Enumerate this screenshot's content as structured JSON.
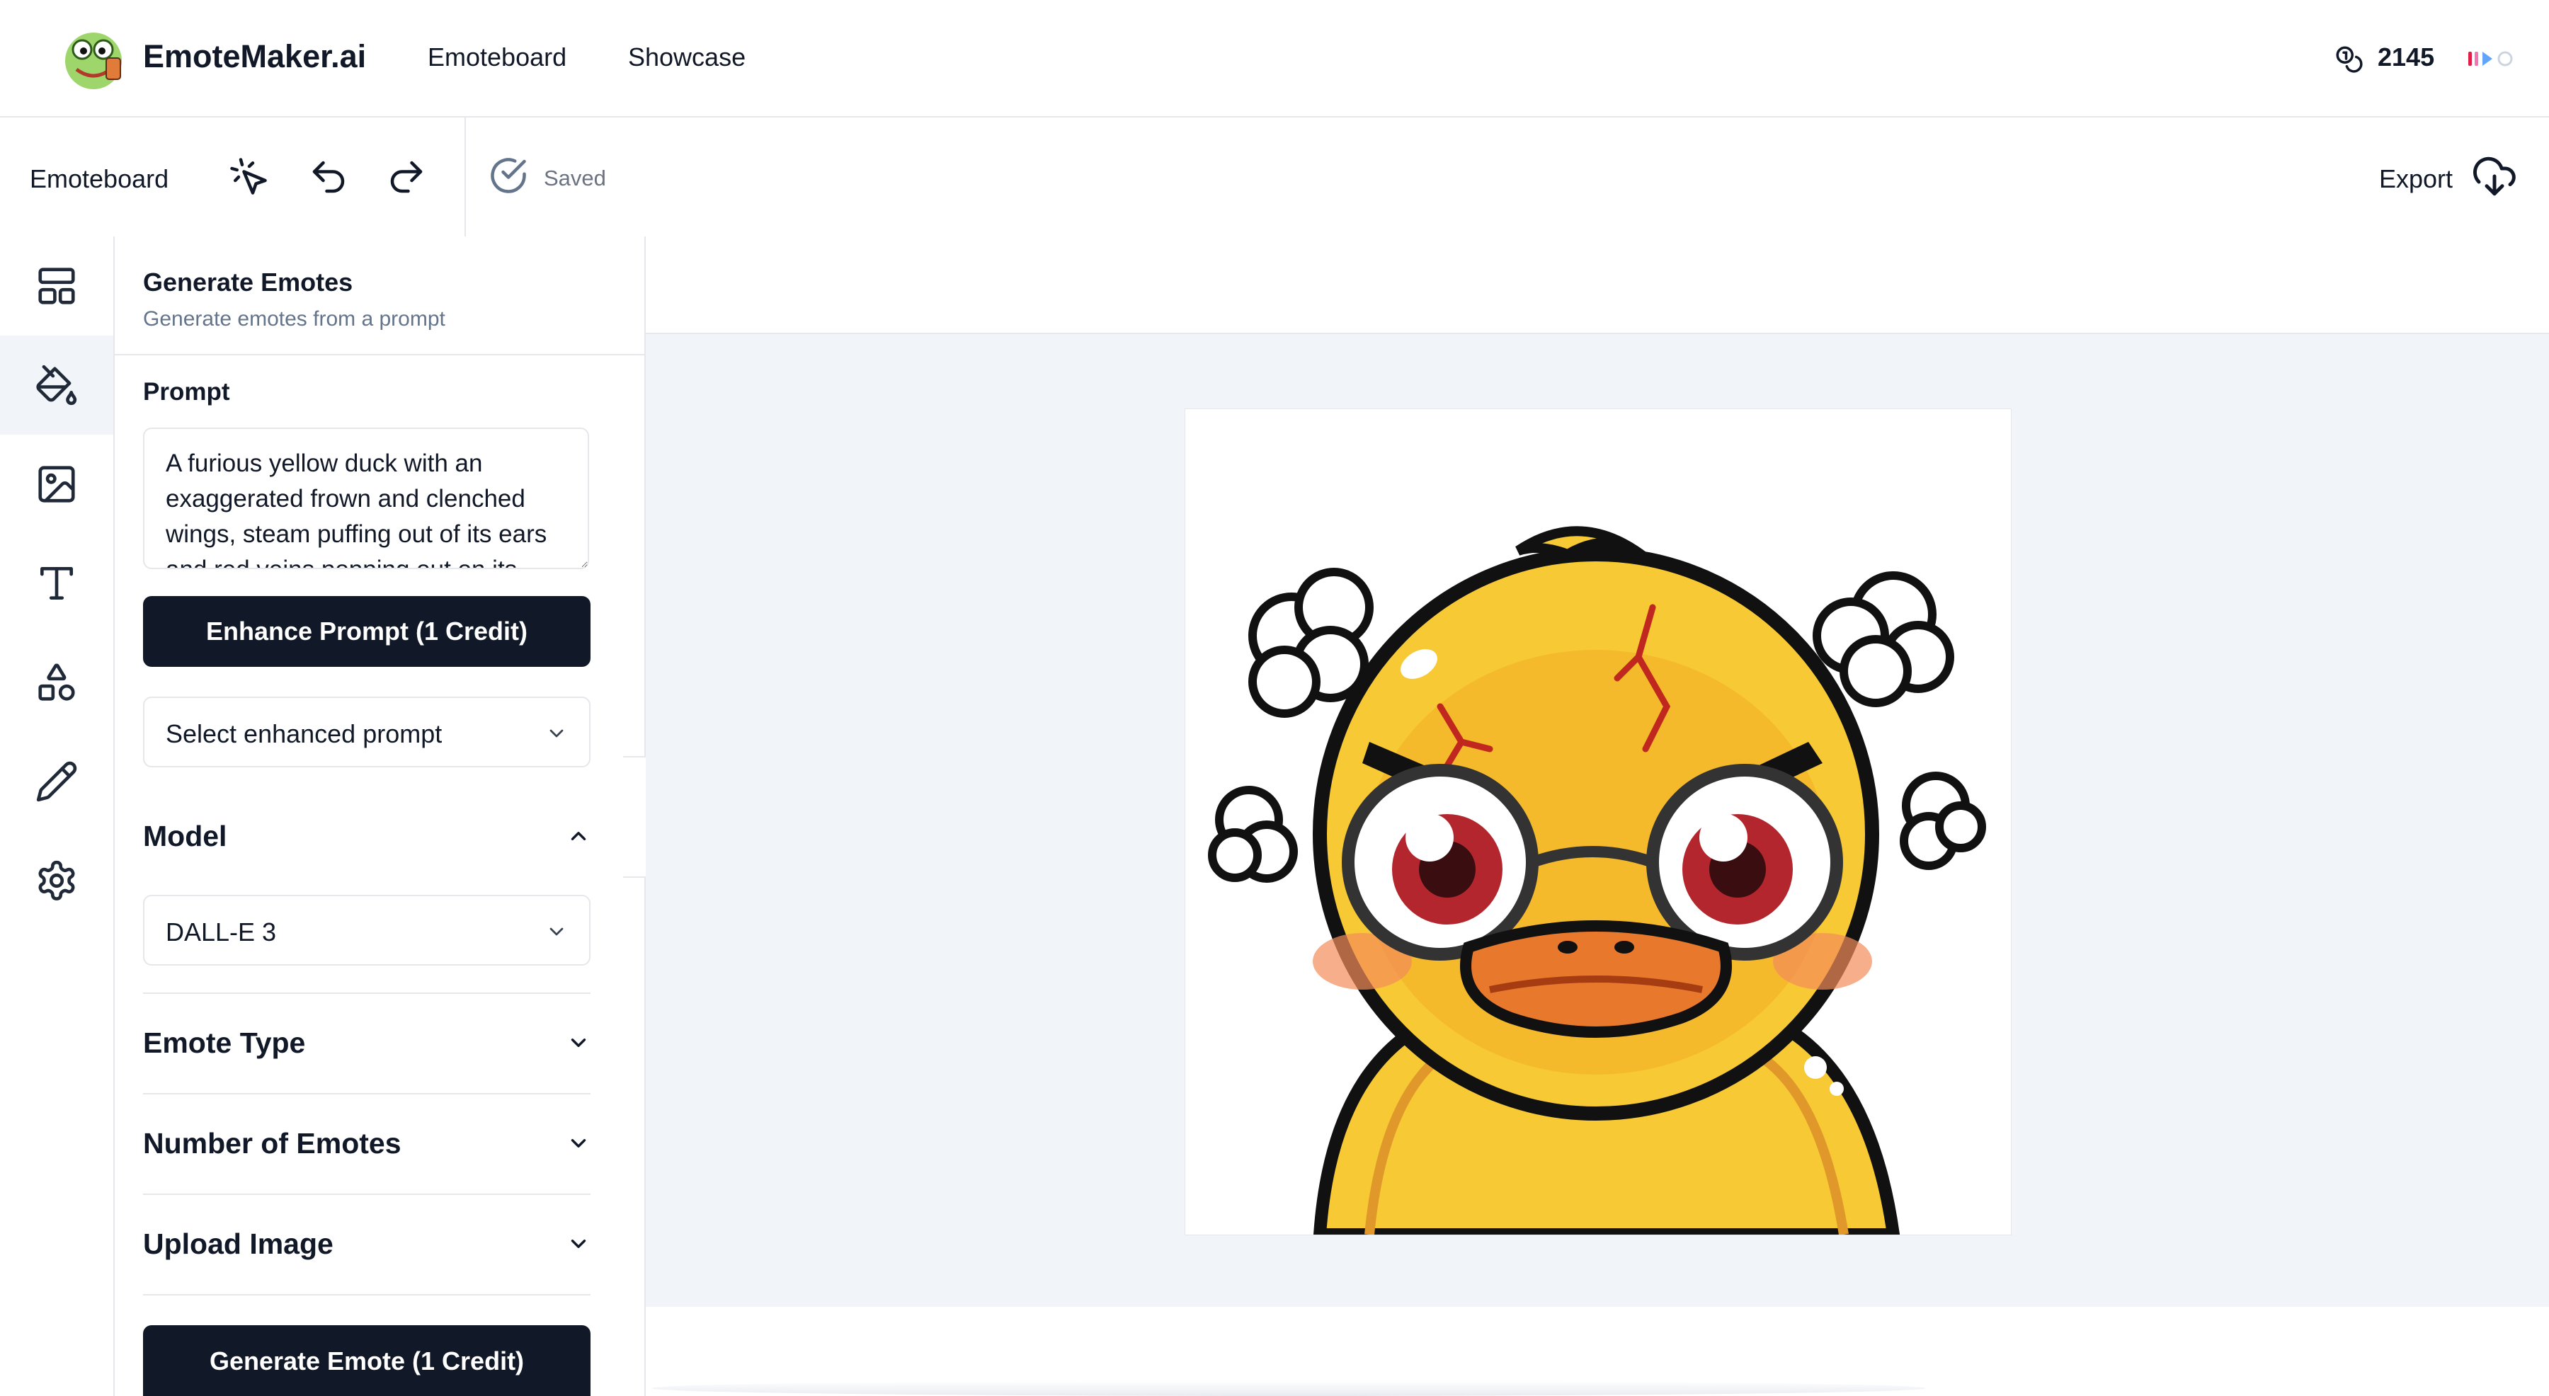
{
  "app": {
    "brand": "EmoteMaker.ai",
    "nav": [
      {
        "label": "Emoteboard"
      },
      {
        "label": "Showcase"
      }
    ],
    "credits": "2145"
  },
  "toolbar": {
    "title": "Emoteboard",
    "save_status": "Saved",
    "export_label": "Export",
    "icons": [
      "pointer-sparkle-icon",
      "undo-icon",
      "redo-icon",
      "check-circle-icon",
      "cloud-download-icon"
    ]
  },
  "rail": {
    "items": [
      {
        "name": "layout-icon",
        "active": false
      },
      {
        "name": "paint-bucket-icon",
        "active": true
      },
      {
        "name": "image-icon",
        "active": false
      },
      {
        "name": "text-icon",
        "active": false
      },
      {
        "name": "shapes-icon",
        "active": false
      },
      {
        "name": "pencil-icon",
        "active": false
      },
      {
        "name": "gear-icon",
        "active": false
      }
    ]
  },
  "panel": {
    "title": "Generate Emotes",
    "subtitle": "Generate emotes from a prompt",
    "prompt_label": "Prompt",
    "prompt_value": "A furious yellow duck with an exaggerated frown and clenched wings, steam puffing out of its ears and red veins popping out on its forehead",
    "enhance_button": "Enhance Prompt (1 Credit)",
    "enhanced_select": "Select enhanced prompt",
    "model_label": "Model",
    "model_value": "DALL-E 3",
    "sections": [
      "Emote Type",
      "Number of Emotes",
      "Upload Image"
    ],
    "generate_button": "Generate Emote (1 Credit)"
  },
  "colors": {
    "primary_dark": "#111827",
    "canvas_bg": "#f1f5f9",
    "border": "#e5e7eb",
    "muted": "#64748b",
    "duck_yellow": "#f7c934",
    "beak_orange": "#e8782c",
    "vein_red": "#c0271f"
  }
}
